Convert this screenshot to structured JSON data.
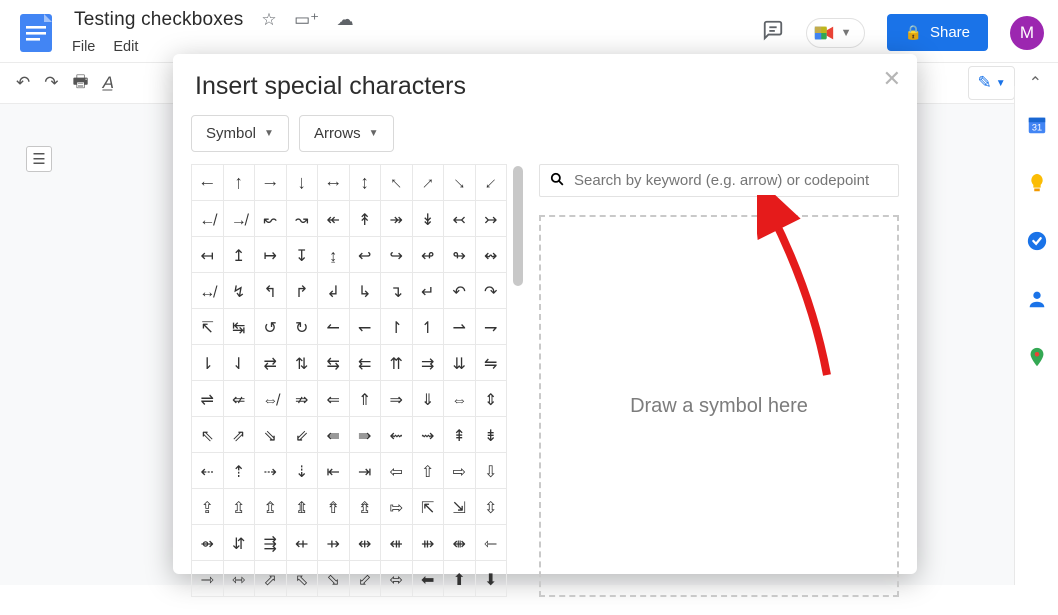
{
  "doc": {
    "title": "Testing checkboxes"
  },
  "menus": {
    "file": "File",
    "edit": "Edit"
  },
  "share": {
    "label": "Share"
  },
  "avatar": {
    "initial": "M"
  },
  "dialog": {
    "title": "Insert special characters",
    "category": "Symbol",
    "subcategory": "Arrows",
    "search_placeholder": "Search by keyword (e.g. arrow) or codepoint",
    "draw_hint": "Draw a symbol here"
  },
  "chars": [
    [
      "←",
      "↑",
      "→",
      "↓",
      "↔",
      "↕",
      "↖",
      "↗",
      "↘",
      "↙"
    ],
    [
      "↚",
      "↛",
      "↜",
      "↝",
      "↞",
      "↟",
      "↠",
      "↡",
      "↢",
      "↣"
    ],
    [
      "↤",
      "↥",
      "↦",
      "↧",
      "↨",
      "↩",
      "↪",
      "↫",
      "↬",
      "↭"
    ],
    [
      "↮",
      "↯",
      "↰",
      "↱",
      "↲",
      "↳",
      "↴",
      "↵",
      "↶",
      "↷"
    ],
    [
      "↸",
      "↹",
      "↺",
      "↻",
      "↼",
      "↽",
      "↾",
      "↿",
      "⇀",
      "⇁"
    ],
    [
      "⇂",
      "⇃",
      "⇄",
      "⇅",
      "⇆",
      "⇇",
      "⇈",
      "⇉",
      "⇊",
      "⇋"
    ],
    [
      "⇌",
      "⇍",
      "⇎",
      "⇏",
      "⇐",
      "⇑",
      "⇒",
      "⇓",
      "⇔",
      "⇕"
    ],
    [
      "⇖",
      "⇗",
      "⇘",
      "⇙",
      "⇚",
      "⇛",
      "⇜",
      "⇝",
      "⇞",
      "⇟"
    ],
    [
      "⇠",
      "⇡",
      "⇢",
      "⇣",
      "⇤",
      "⇥",
      "⇦",
      "⇧",
      "⇨",
      "⇩"
    ],
    [
      "⇪",
      "⇫",
      "⇬",
      "⇭",
      "⇮",
      "⇯",
      "⇰",
      "⇱",
      "⇲",
      "⇳"
    ],
    [
      "⇴",
      "⇵",
      "⇶",
      "⇷",
      "⇸",
      "⇹",
      "⇺",
      "⇻",
      "⇼",
      "⇽"
    ],
    [
      "⇾",
      "⇿",
      "⬀",
      "⬁",
      "⬂",
      "⬃",
      "⬄",
      "⬅",
      "⬆",
      "⬇"
    ]
  ]
}
